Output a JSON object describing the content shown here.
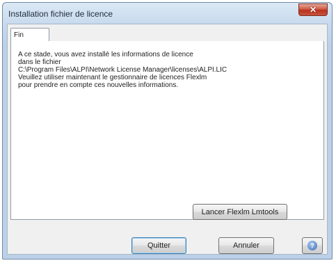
{
  "window": {
    "title": "Installation fichier de licence",
    "close_glyph": "✕"
  },
  "tabs": [
    {
      "label": "Fin"
    }
  ],
  "message": {
    "lines": [
      "A ce stade, vous avez installé les informations de licence",
      "dans le fichier",
      "C:\\Program Files\\ALPI\\Network License Manager\\licenses\\ALPI.LIC",
      "Veuillez utiliser maintenant le gestionnaire de licences Flexlm",
      "pour prendre en compte ces nouvelles informations."
    ]
  },
  "buttons": {
    "launch_label": "Lancer Flexlm Lmtools",
    "quit_label": "Quitter",
    "cancel_label": "Annuler",
    "help_icon": "help-icon",
    "help_glyph": "?"
  }
}
